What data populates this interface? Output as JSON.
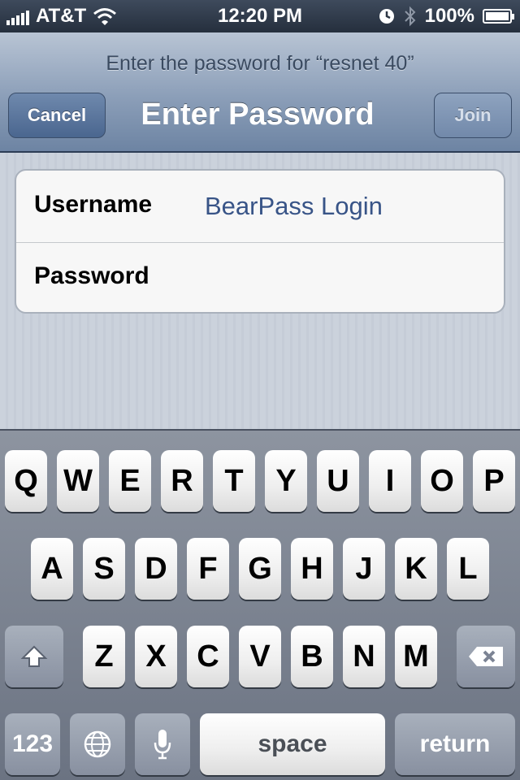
{
  "status_bar": {
    "carrier": "AT&T",
    "time": "12:20 PM",
    "battery_percent": "100%",
    "icons": [
      "signal-icon",
      "wifi-icon",
      "lock-rotation-icon",
      "bluetooth-icon",
      "battery-icon"
    ]
  },
  "nav": {
    "prompt": "Enter the password for “resnet 40”",
    "title": "Enter Password",
    "cancel_label": "Cancel",
    "join_label": "Join"
  },
  "form": {
    "username_label": "Username",
    "username_value": "BearPass Login",
    "password_label": "Password",
    "password_value": ""
  },
  "keyboard": {
    "row1": [
      "Q",
      "W",
      "E",
      "R",
      "T",
      "Y",
      "U",
      "I",
      "O",
      "P"
    ],
    "row2": [
      "A",
      "S",
      "D",
      "F",
      "G",
      "H",
      "J",
      "K",
      "L"
    ],
    "row3": [
      "Z",
      "X",
      "C",
      "V",
      "B",
      "N",
      "M"
    ],
    "numbers_label": "123",
    "space_label": "space",
    "return_label": "return"
  },
  "colors": {
    "link_value": "#385487",
    "nav_dark": "#2d3d55"
  }
}
